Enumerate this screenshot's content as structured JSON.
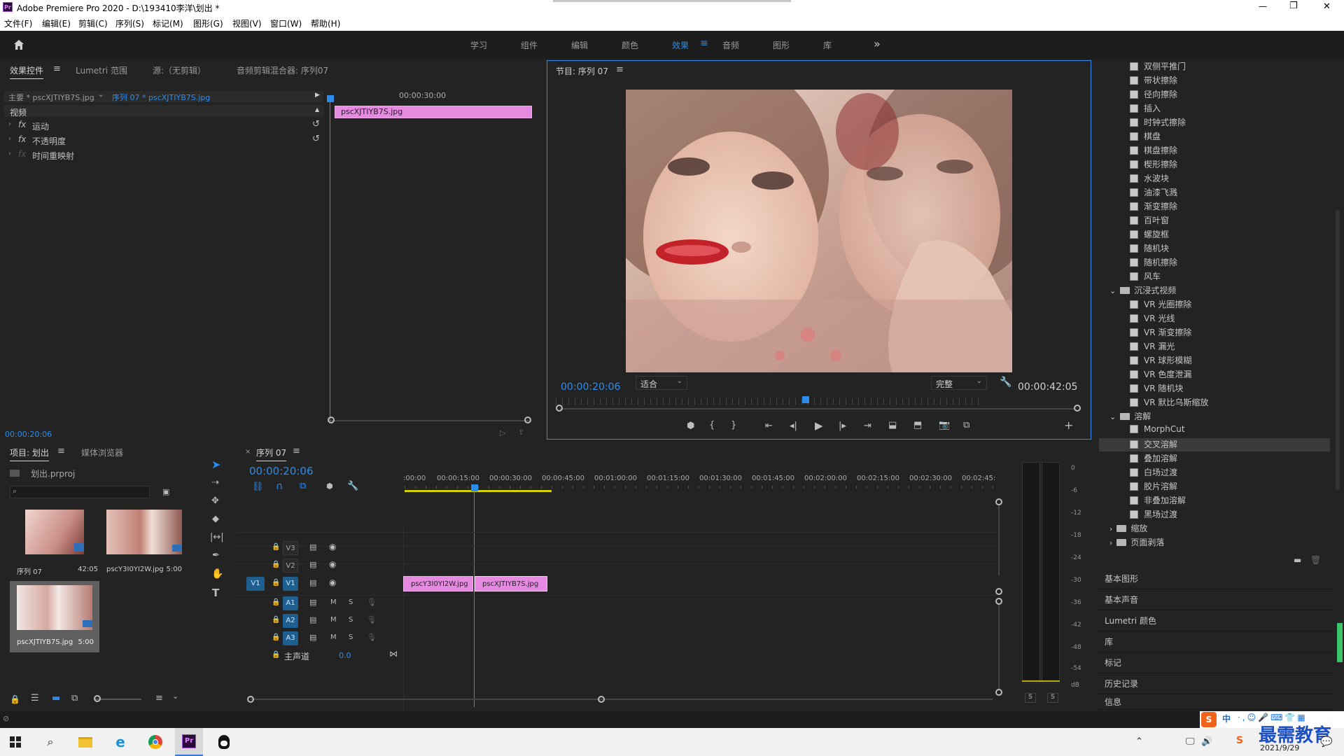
{
  "window": {
    "title": "Adobe Premiere Pro 2020 - D:\\193410李洋\\划出 *",
    "minimize": "—",
    "maximize": "❐",
    "close": "✕"
  },
  "menu": [
    "文件(F)",
    "编辑(E)",
    "剪辑(C)",
    "序列(S)",
    "标记(M)",
    "图形(G)",
    "视图(V)",
    "窗口(W)",
    "帮助(H)"
  ],
  "workspaces": [
    "学习",
    "组件",
    "编辑",
    "颜色",
    "效果",
    "音频",
    "图形",
    "库"
  ],
  "active_workspace": "效果",
  "effect_controls": {
    "tabs": [
      "效果控件",
      "Lumetri 范围",
      "源:（无剪辑）",
      "音频剪辑混合器: 序列07"
    ],
    "master": "主要 * pscXJTIYB7S.jpg",
    "sequence": "序列 07 * pscXJTIYB7S.jpg",
    "time_marker": "00:00:30:00",
    "section": "视频",
    "clip_name": "pscXJTIYB7S.jpg",
    "rows": [
      "运动",
      "不透明度",
      "时间重映射"
    ],
    "fx": "fx",
    "timecode": "00:00:20:06"
  },
  "program": {
    "title": "节目: 序列 07",
    "timecode": "00:00:20:06",
    "fit": "适合",
    "quality": "完整",
    "duration": "00:00:42:05"
  },
  "project": {
    "tabs": [
      "项目: 划出",
      "媒体浏览器"
    ],
    "file": "划出.prproj",
    "items": [
      {
        "name": "序列 07",
        "dur": "42:05"
      },
      {
        "name": "pscY3I0YI2W.jpg",
        "dur": "5:00"
      },
      {
        "name": "pscXJTIYB7S.jpg",
        "dur": "5:00"
      }
    ]
  },
  "timeline": {
    "tab": "序列 07",
    "timecode": "00:00:20:06",
    "ruler": [
      ":00:00",
      "00:00:15:00",
      "00:00:30:00",
      "00:00:45:00",
      "00:01:00:00",
      "00:01:15:00",
      "00:01:30:00",
      "00:01:45:00",
      "00:02:00:00",
      "00:02:15:00",
      "00:02:30:00",
      "00:02:45:"
    ],
    "tracks": [
      "V3",
      "V2",
      "V1",
      "A1",
      "A2",
      "A3"
    ],
    "src_v1": "V1",
    "master": "主声道",
    "master_val": "0.0",
    "m": "M",
    "s": "S",
    "clips": [
      "pscY3I0YI2W.jpg",
      "pscXJTIYB7S.jpg"
    ]
  },
  "meters": {
    "labels": [
      "0",
      "-6",
      "-12",
      "-18",
      "-24",
      "-30",
      "-36",
      "-42",
      "-48",
      "-54",
      "dB"
    ],
    "solo": [
      "S",
      "S"
    ]
  },
  "effects": {
    "items_top": [
      "双侧平推门",
      "带状擦除",
      "径向擦除",
      "插入",
      "时钟式擦除",
      "棋盘",
      "棋盘擦除",
      "楔形擦除",
      "水波块",
      "油漆飞溅",
      "渐变擦除",
      "百叶窗",
      "螺旋框",
      "随机块",
      "随机擦除",
      "风车"
    ],
    "folder_vr": "沉浸式视频",
    "items_vr": [
      "VR 光圈擦除",
      "VR 光线",
      "VR 渐变擦除",
      "VR 漏光",
      "VR 球形模糊",
      "VR 色度泄漏",
      "VR 随机块",
      "VR 默比乌斯缩放"
    ],
    "folder_dissolve": "溶解",
    "items_dissolve": [
      "MorphCut",
      "交叉溶解",
      "叠加溶解",
      "白场过渡",
      "胶片溶解",
      "非叠加溶解",
      "黑场过渡"
    ],
    "selected": "交叉溶解",
    "folders_bottom": [
      "缩放",
      "页面剥落"
    ]
  },
  "side_panels": [
    "基本图形",
    "基本声音",
    "Lumetri 颜色",
    "库",
    "标记",
    "历史记录",
    "信息"
  ],
  "taskbar": {
    "date": "2021/9/29",
    "ime": "中",
    "watermark": "最需教育"
  }
}
